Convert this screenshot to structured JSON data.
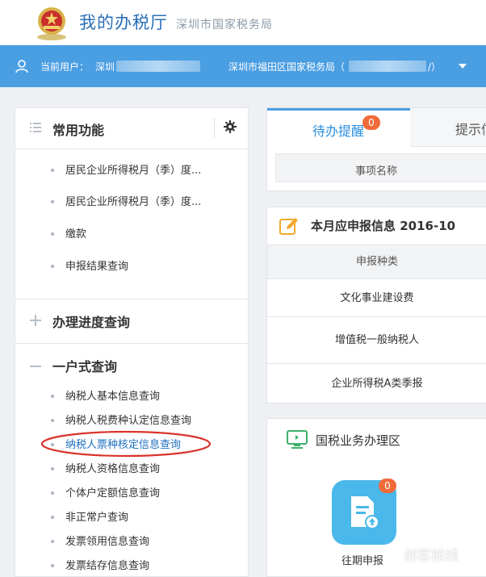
{
  "header": {
    "app_title": "我的办税厅",
    "subtitle": "深圳市国家税务局"
  },
  "userbar": {
    "user_label": "当前用户：",
    "user_value": "深圳",
    "org_label": "深圳市福田区国家税务局（",
    "org_close": "/）"
  },
  "left": {
    "common": {
      "title": "常用功能",
      "items": [
        "居民企业所得税月（季）度...",
        "居民企业所得税月（季）度...",
        "缴款",
        "申报结果查询"
      ]
    },
    "progress": {
      "title": "办理进度查询"
    },
    "onestop": {
      "title": "一户式查询",
      "items": [
        "纳税人基本信息查询",
        "纳税人税费种认定信息查询",
        "纳税人票种核定信息查询",
        "纳税人资格信息查询",
        "个体户定额信息查询",
        "非正常户查询",
        "发票领用信息查询",
        "发票结存信息查询"
      ],
      "highlighted_index": 2
    }
  },
  "tabs": {
    "active": {
      "label": "待办提醒",
      "badge": "0"
    },
    "inactive": {
      "label": "提示信"
    },
    "column_header": "事项名称"
  },
  "declaration": {
    "title": "本月应申报信息 2016-10",
    "header": "申报种类",
    "rows": [
      "文化事业建设费",
      "增值税一般纳税人",
      "企业所得税A类季报"
    ]
  },
  "business": {
    "title": "国税业务办理区",
    "tile_label": "往期申报",
    "tile_badge": "0"
  },
  "watermark": {
    "text": "创客前线"
  },
  "colors": {
    "accent_blue": "#4a9ee2",
    "highlight_red": "#d9342b",
    "badge_orange": "#f06a3a",
    "tile_blue": "#4ab8ea"
  }
}
